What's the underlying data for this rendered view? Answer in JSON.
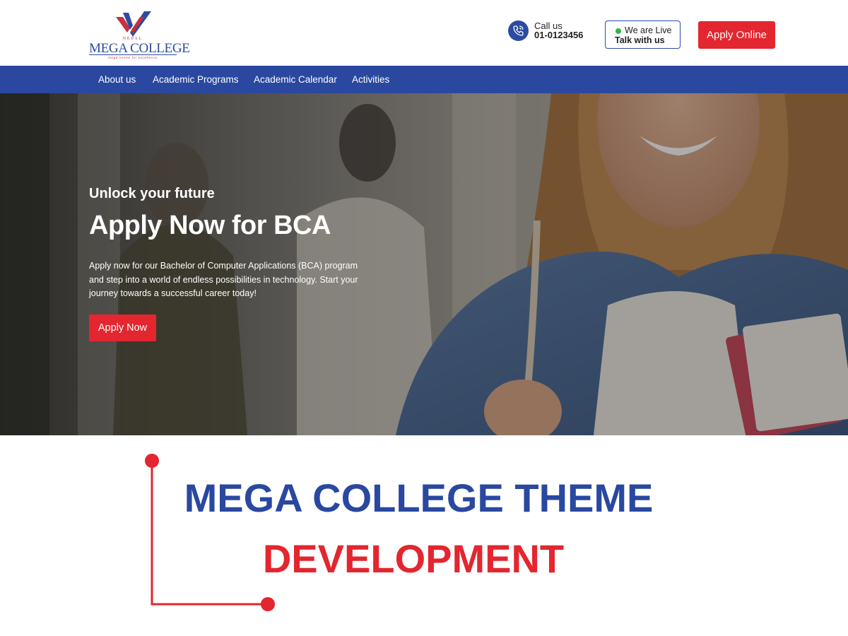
{
  "header": {
    "logo": {
      "country": "NEPAL",
      "name": "MEGA COLLEGE",
      "tagline": "mega centre for excellence"
    },
    "call": {
      "label": "Call us",
      "number": "01-0123456",
      "icon": "phone-icon"
    },
    "live": {
      "label": "We are Live",
      "cta": "Talk with us",
      "status_color": "#2eb84a"
    },
    "apply_button": "Apply Online"
  },
  "nav": {
    "items": [
      {
        "label": "About us"
      },
      {
        "label": "Academic Programs"
      },
      {
        "label": "Academic Calendar"
      },
      {
        "label": "Activities"
      }
    ]
  },
  "hero": {
    "kicker": "Unlock your future",
    "headline": "Apply Now for BCA",
    "description": "Apply now for our Bachelor of Computer Applications (BCA) program and step into a world of endless possibilities in technology. Start your journey towards a successful career today!",
    "button": "Apply Now"
  },
  "banner": {
    "line1": "MEGA COLLEGE THEME",
    "line2": "DEVELOPMENT"
  },
  "colors": {
    "brand_blue": "#2a48a0",
    "brand_red": "#e3262f"
  }
}
